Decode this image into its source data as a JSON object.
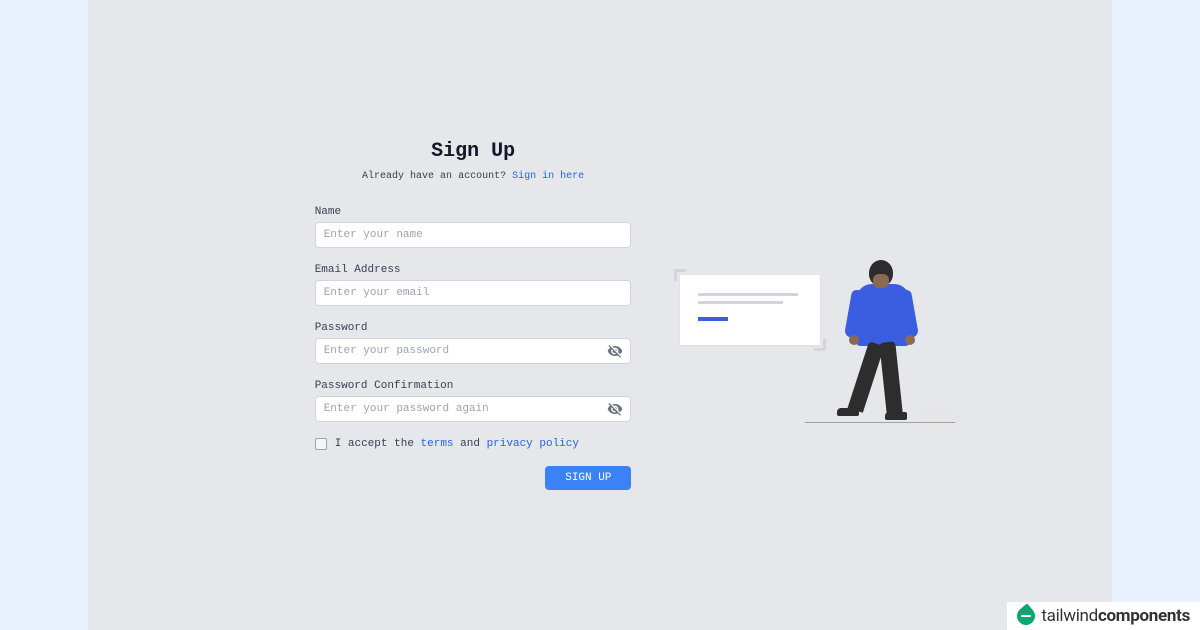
{
  "header": {
    "title": "Sign Up",
    "subtitle_prefix": "Already have an account? ",
    "subtitle_link": "Sign in here"
  },
  "form": {
    "name": {
      "label": "Name",
      "placeholder": "Enter your name"
    },
    "email": {
      "label": "Email Address",
      "placeholder": "Enter your email"
    },
    "password": {
      "label": "Password",
      "placeholder": "Enter your password"
    },
    "password_confirm": {
      "label": "Password Confirmation",
      "placeholder": "Enter your password again"
    },
    "terms": {
      "prefix": "I accept the ",
      "terms_link": "terms",
      "middle": " and ",
      "privacy_link": "privacy policy"
    },
    "submit_label": "SIGN UP"
  },
  "brand": {
    "light": "tailwind",
    "bold": "components"
  }
}
